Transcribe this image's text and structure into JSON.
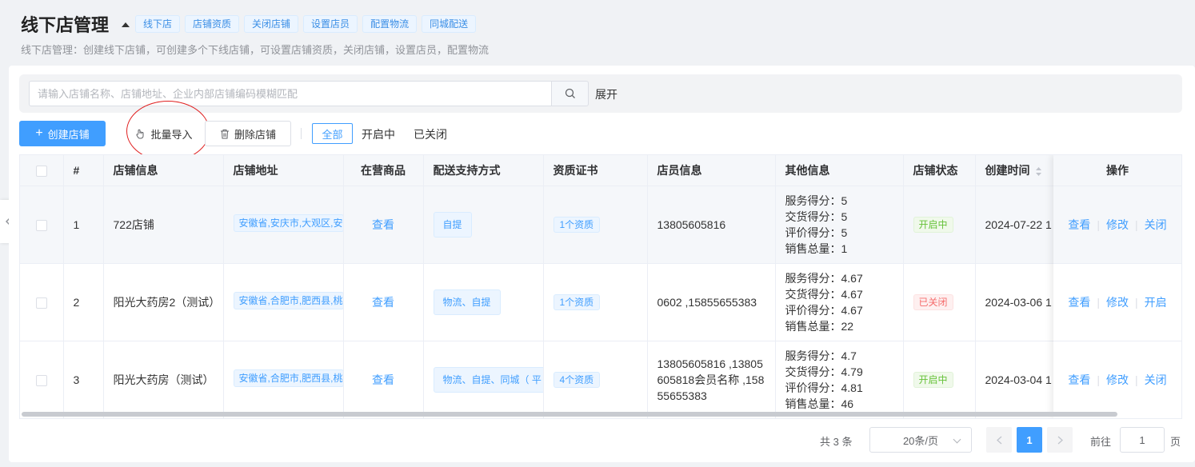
{
  "header": {
    "title": "线下店管理",
    "tags": [
      "线下店",
      "店铺资质",
      "关闭店铺",
      "设置店员",
      "配置物流",
      "同城配送"
    ],
    "description": "线下店管理：创建线下店铺，可创建多个下线店铺，可设置店铺资质，关闭店铺，设置店员，配置物流"
  },
  "search": {
    "placeholder": "请输入店铺名称、店铺地址、企业内部店铺编码模糊匹配",
    "value": "",
    "expand_label": "展开"
  },
  "toolbar": {
    "create_label": "创建店铺",
    "import_label": "批量导入",
    "delete_label": "删除店铺",
    "filters": [
      "全部",
      "开启中",
      "已关闭"
    ],
    "active_filter": "全部"
  },
  "table": {
    "columns": [
      "#",
      "店铺信息",
      "店铺地址",
      "在营商品",
      "配送支持方式",
      "资质证书",
      "店员信息",
      "其他信息",
      "店铺状态",
      "创建时间",
      "操作"
    ],
    "rows": [
      {
        "index": "1",
        "name": "722店铺",
        "address": "安徽省,安庆市,大观区,安",
        "goods": "查看",
        "shipping": "自提",
        "cert": "1个资质",
        "staff": "13805605816",
        "other": [
          "服务得分：5",
          "交货得分：5",
          "评价得分：5",
          "销售总量：1"
        ],
        "status": "开启中",
        "status_type": "open",
        "created": "2024-07-22 1",
        "ops": [
          "查看",
          "修改",
          "关闭"
        ]
      },
      {
        "index": "2",
        "name": "阳光大药房2（测试）",
        "address": "安徽省,合肥市,肥西县,桃",
        "goods": "查看",
        "shipping": "物流、自提",
        "cert": "1个资质",
        "staff": "0602 ,15855655383",
        "other": [
          "服务得分：4.67",
          "交货得分：4.67",
          "评价得分：4.67",
          "销售总量：22"
        ],
        "status": "已关闭",
        "status_type": "closed",
        "created": "2024-03-06 1",
        "ops": [
          "查看",
          "修改",
          "开启"
        ]
      },
      {
        "index": "3",
        "name": "阳光大药房（测试）",
        "address": "安徽省,合肥市,肥西县,桃",
        "goods": "查看",
        "shipping": "物流、自提、同城（ 平",
        "cert": "4个资质",
        "staff": "13805605816 ,13805605818会员名称 ,15855655383",
        "other": [
          "服务得分：4.7",
          "交货得分：4.79",
          "评价得分：4.81",
          "销售总量：46"
        ],
        "status": "开启中",
        "status_type": "open",
        "created": "2024-03-04 1",
        "ops": [
          "查看",
          "修改",
          "关闭"
        ]
      }
    ]
  },
  "pagination": {
    "total": "共 3 条",
    "page_size": "20条/页",
    "current_page": "1",
    "goto_label": "前往",
    "goto_value": "1",
    "page_suffix": "页"
  },
  "colors": {
    "primary": "#409eff",
    "success": "#67c23a",
    "danger": "#f56c6c",
    "annotation": "#e02020"
  }
}
